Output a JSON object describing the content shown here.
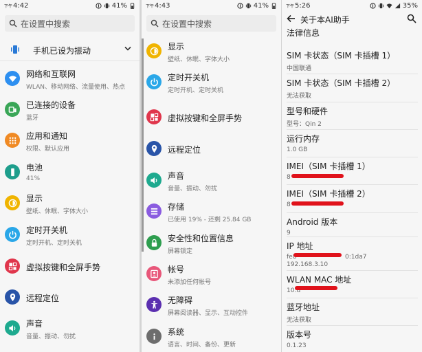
{
  "panel1": {
    "status": {
      "prefix": "下午",
      "time": "4:42",
      "battery": "41%"
    },
    "search_placeholder": "在设置中搜索",
    "vibrate_label": "手机已设为振动",
    "items": [
      {
        "title": "网络和互联网",
        "sub": "WLAN、移动网络、流量使用、热点",
        "color": "#2d8ff0",
        "icon": "wifi-icon"
      },
      {
        "title": "已连接的设备",
        "sub": "蓝牙",
        "color": "#3aa657",
        "icon": "devices-icon"
      },
      {
        "title": "应用和通知",
        "sub": "权限、默认应用",
        "color": "#f08a24",
        "icon": "apps-icon"
      },
      {
        "title": "电池",
        "sub": "41%",
        "color": "#1e9e8c",
        "icon": "battery-icon"
      },
      {
        "title": "显示",
        "sub": "壁纸、休眠、字体大小",
        "color": "#f0b400",
        "icon": "brightness-icon"
      },
      {
        "title": "定时开关机",
        "sub": "定时开机、定时关机",
        "color": "#2aa7e8",
        "icon": "power-icon"
      },
      {
        "title": "虚拟按键和全屏手势",
        "sub": "",
        "color": "#e0364c",
        "icon": "gesture-icon"
      },
      {
        "title": "远程定位",
        "sub": "",
        "color": "#2954a8",
        "icon": "location-icon"
      },
      {
        "title": "声音",
        "sub": "音量、振动、勿扰",
        "color": "#1eaa8f",
        "icon": "sound-icon"
      }
    ]
  },
  "panel2": {
    "status": {
      "prefix": "下午",
      "time": "4:43",
      "battery": "41%"
    },
    "search_placeholder": "在设置中搜索",
    "items": [
      {
        "title": "显示",
        "sub": "壁纸、休眠、字体大小",
        "color": "#f0b400",
        "icon": "brightness-icon"
      },
      {
        "title": "定时开关机",
        "sub": "定时开机、定时关机",
        "color": "#2aa7e8",
        "icon": "power-icon"
      },
      {
        "title": "虚拟按键和全屏手势",
        "sub": "",
        "color": "#e0364c",
        "icon": "gesture-icon"
      },
      {
        "title": "远程定位",
        "sub": "",
        "color": "#2954a8",
        "icon": "location-icon"
      },
      {
        "title": "声音",
        "sub": "音量、振动、勿扰",
        "color": "#1eaa8f",
        "icon": "sound-icon"
      },
      {
        "title": "存储",
        "sub": "已使用 19% - 还剩 25.84 GB",
        "color": "#8a5be0",
        "icon": "storage-icon"
      },
      {
        "title": "安全性和位置信息",
        "sub": "屏幕锁定",
        "color": "#2e9e4f",
        "icon": "lock-icon"
      },
      {
        "title": "帐号",
        "sub": "未添加任何帐号",
        "color": "#e8577a",
        "icon": "account-icon"
      },
      {
        "title": "无障碍",
        "sub": "屏幕阅读器、显示、互动控件",
        "color": "#5b2fb0",
        "icon": "accessibility-icon"
      },
      {
        "title": "系统",
        "sub": "语言、时间、备份、更新",
        "color": "#6d6d6d",
        "icon": "info-icon"
      }
    ]
  },
  "panel3": {
    "status": {
      "prefix": "下午",
      "time": "5:26",
      "battery": "35%"
    },
    "title": "关于本AI助手",
    "items": [
      {
        "title": "法律信息",
        "sub": ""
      },
      {
        "title": "SIM 卡状态（SIM 卡插槽 1）",
        "sub": "中国联通"
      },
      {
        "title": "SIM 卡状态（SIM 卡插槽 2）",
        "sub": "无法获取"
      },
      {
        "title": "型号和硬件",
        "sub": "型号：Qin 2"
      },
      {
        "title": "运行内存",
        "sub": "1.0 GB"
      },
      {
        "title": "IMEI（SIM 卡插槽 1）",
        "sub": "8"
      },
      {
        "title": "IMEI（SIM 卡插槽 2）",
        "sub": "8"
      },
      {
        "title": "Android 版本",
        "sub": "9"
      },
      {
        "title": "IP 地址",
        "sub": "fe8",
        "sub_tail": "0:1da7",
        "sub2": "192.168.3.10"
      },
      {
        "title": "WLAN MAC 地址",
        "sub": "10:d"
      },
      {
        "title": "蓝牙地址",
        "sub": "无法获取"
      },
      {
        "title": "版本号",
        "sub": "0.1.23"
      }
    ]
  }
}
